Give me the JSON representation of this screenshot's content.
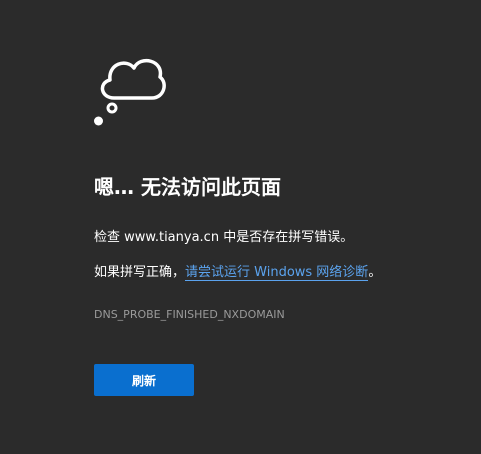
{
  "error_page": {
    "icon": "cloud-thought-bubble-icon",
    "heading": "嗯… 无法访问此页面",
    "check_prefix": "检查 ",
    "domain": "www.tianya.cn",
    "check_suffix": " 中是否存在拼写错误。",
    "spelling_prefix": "如果拼写正确，",
    "diagnostics_link": "请尝试运行 Windows 网络诊断",
    "spelling_suffix": "。",
    "error_code": "DNS_PROBE_FINISHED_NXDOMAIN",
    "reload_button": "刷新"
  },
  "colors": {
    "background": "#2b2b2b",
    "text": "#ffffff",
    "link": "#5ba3ee",
    "error_code": "#9a9a9a",
    "button": "#0a6fcf"
  }
}
